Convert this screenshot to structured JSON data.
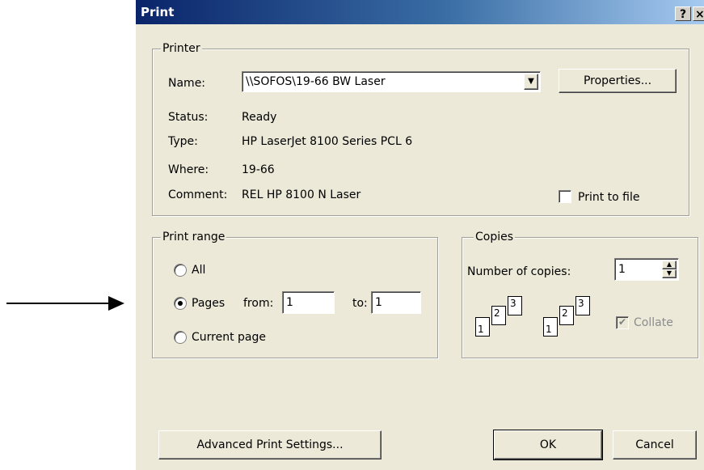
{
  "window": {
    "title": "Print",
    "help_glyph": "?",
    "close_glyph": "×"
  },
  "printer": {
    "legend": "Printer",
    "name_label": "Name:",
    "name_value": "\\\\SOFOS\\19-66 BW Laser",
    "status_label": "Status:",
    "status_value": "Ready",
    "type_label": "Type:",
    "type_value": "HP LaserJet 8100 Series PCL 6",
    "where_label": "Where:",
    "where_value": "19-66",
    "comment_label": "Comment:",
    "comment_value": "REL HP 8100 N Laser",
    "properties_label": "Properties...",
    "print_to_file_label": "Print to file",
    "print_to_file_checked": false
  },
  "print_range": {
    "legend": "Print range",
    "all_label": "All",
    "pages_label": "Pages",
    "from_label": "from:",
    "from_value": "1",
    "to_label": "to:",
    "to_value": "1",
    "current_label": "Current page",
    "selected": "pages"
  },
  "copies": {
    "legend": "Copies",
    "number_label": "Number of copies:",
    "number_value": "1",
    "collate_label": "Collate",
    "collate_checked": true,
    "collate_enabled": false,
    "pages": [
      "1",
      "2",
      "3"
    ]
  },
  "footer": {
    "advanced_label": "Advanced Print Settings...",
    "ok_label": "OK",
    "cancel_label": "Cancel"
  },
  "colors": {
    "title_start": "#0a246a",
    "title_end": "#a6caf0",
    "dialog_bg": "#ece9d8"
  }
}
